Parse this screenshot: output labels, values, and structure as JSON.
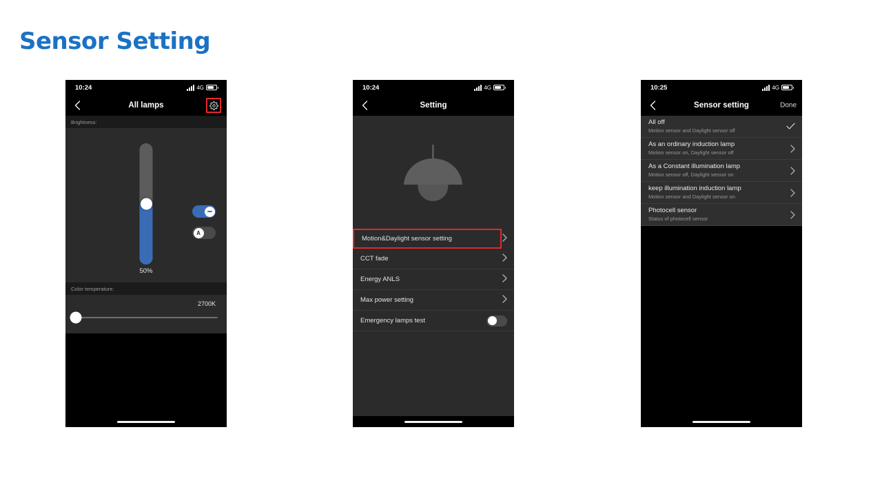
{
  "page": {
    "title": "Sensor Setting",
    "accent_color": "#1b72c4",
    "highlight_color": "#e8262b"
  },
  "screen1": {
    "status": {
      "time": "10:24",
      "network": "4G",
      "signal_icon": "signal-bars-icon",
      "battery_icon": "battery-icon"
    },
    "nav": {
      "back_icon": "chevron-left-icon",
      "title": "All lamps",
      "action_icon": "gear-icon"
    },
    "brightness": {
      "label": "Brightness:",
      "value_label": "50%",
      "value_percent": 50,
      "dim_toggle": {
        "name": "minus-toggle",
        "state": "on",
        "icon": "minus-icon"
      },
      "auto_toggle": {
        "name": "auto-toggle",
        "state": "off",
        "icon": "auto-a-icon",
        "glyph": "A"
      }
    },
    "color_temperature": {
      "label": "Color temperature:",
      "value_label": "2700K",
      "slider_percent": 0
    }
  },
  "screen2": {
    "status": {
      "time": "10:24",
      "network": "4G",
      "signal_icon": "signal-bars-icon",
      "battery_icon": "battery-icon"
    },
    "nav": {
      "back_icon": "chevron-left-icon",
      "title": "Setting"
    },
    "lamp_icon": "pendant-lamp-icon",
    "menu": [
      {
        "label": "Motion&Daylight sensor setting",
        "control": "chevron",
        "highlighted": true
      },
      {
        "label": "CCT fade",
        "control": "chevron",
        "highlighted": false
      },
      {
        "label": "Energy ANLS",
        "control": "chevron",
        "highlighted": false
      },
      {
        "label": "Max power setting",
        "control": "chevron",
        "highlighted": false
      },
      {
        "label": "Emergency lamps test",
        "control": "toggle",
        "toggle_state": "off",
        "highlighted": false
      }
    ]
  },
  "screen3": {
    "status": {
      "time": "10:25",
      "network": "4G",
      "signal_icon": "signal-bars-icon",
      "battery_icon": "battery-icon"
    },
    "nav": {
      "back_icon": "chevron-left-icon",
      "title": "Sensor setting",
      "action_label": "Done"
    },
    "options": [
      {
        "title": "All off",
        "subtitle": "Motion sensor and Daylight sensor off",
        "mark": "check",
        "selected": true
      },
      {
        "title": "As an ordinary induction lamp",
        "subtitle": "Motion sensor on,  Daylight sensor off",
        "mark": "chevron",
        "selected": false
      },
      {
        "title": "As a Constant illumination lamp",
        "subtitle": "Motion sensor off,  Daylight sensor on",
        "mark": "chevron",
        "selected": false
      },
      {
        "title": "keep illumination induction lamp",
        "subtitle": "Motion sensor and Daylight sensor on",
        "mark": "chevron",
        "selected": false
      },
      {
        "title": "Photocell sensor",
        "subtitle": "Status of photocell sensor",
        "mark": "chevron",
        "selected": false
      }
    ]
  }
}
